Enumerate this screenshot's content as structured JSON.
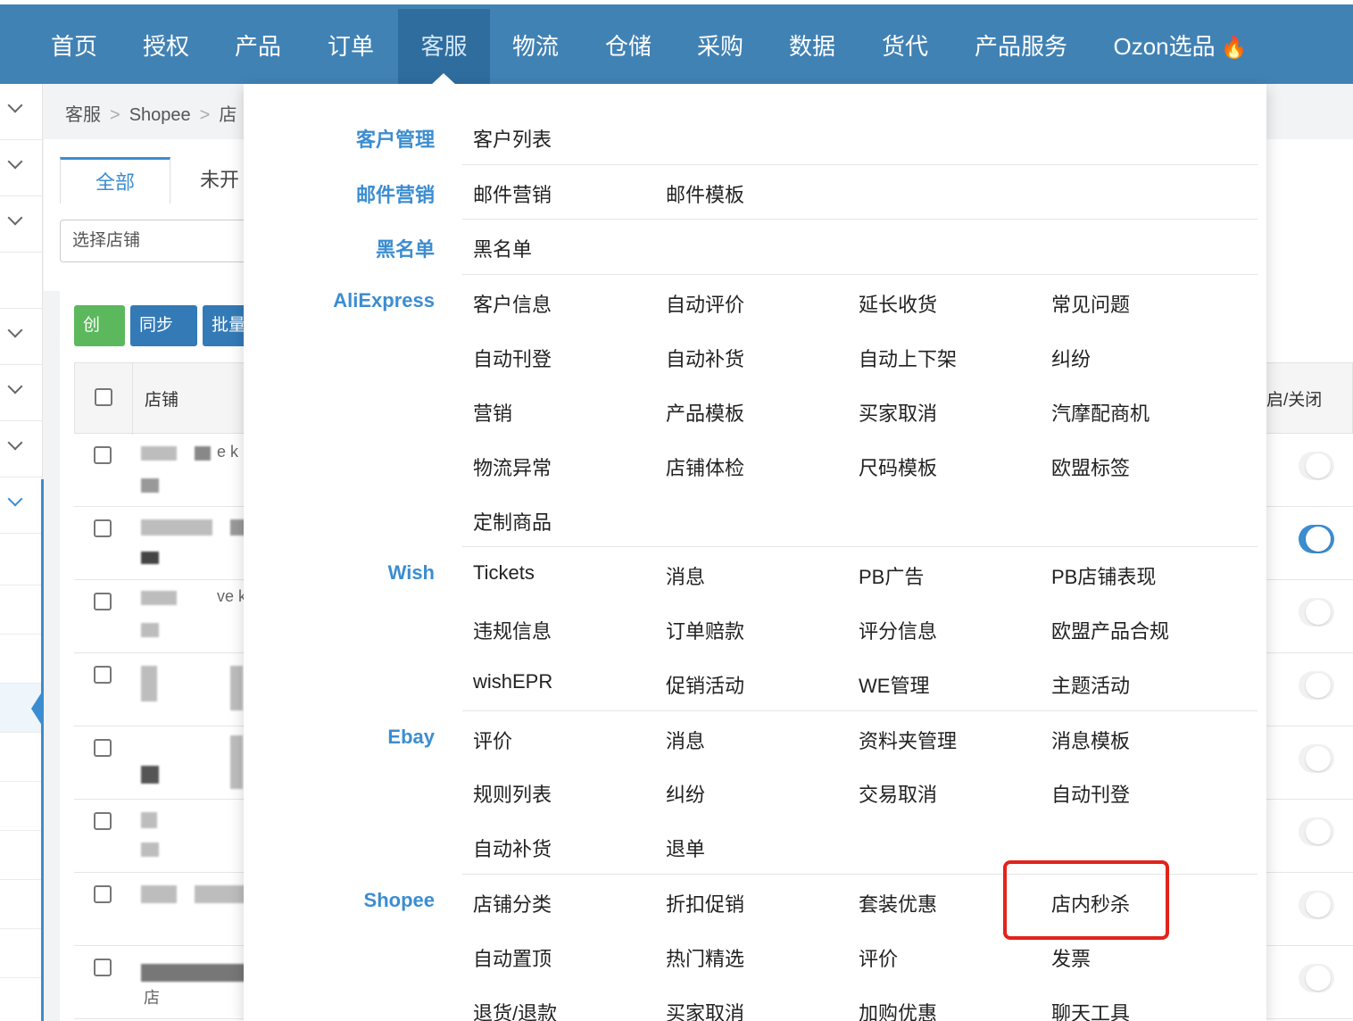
{
  "nav": {
    "items": [
      "首页",
      "授权",
      "产品",
      "订单",
      "客服",
      "物流",
      "仓储",
      "采购",
      "数据",
      "货代",
      "产品服务",
      "Ozon选品"
    ],
    "active": "客服",
    "fire_icon": "fire-icon"
  },
  "breadcrumb": [
    "客服",
    "Shopee",
    "店"
  ],
  "tabs": [
    "全部",
    "未开"
  ],
  "select_shop_placeholder": "选择店铺",
  "buttons": {
    "create": "创建",
    "sync": "同步",
    "batch": "批量"
  },
  "table": {
    "col_shop": "店铺",
    "col_switch": "启/关闭",
    "row_text_1": "e k",
    "row_text_3": "ve k",
    "row_text_8": "店"
  },
  "menu": {
    "groups": [
      {
        "category": "客户管理",
        "rows": [
          [
            "客户列表"
          ]
        ]
      },
      {
        "category": "邮件营销",
        "rows": [
          [
            "邮件营销",
            "邮件模板"
          ]
        ]
      },
      {
        "category": "黑名单",
        "rows": [
          [
            "黑名单"
          ]
        ]
      },
      {
        "category": "AliExpress",
        "rows": [
          [
            "客户信息",
            "自动评价",
            "延长收货",
            "常见问题"
          ],
          [
            "自动刊登",
            "自动补货",
            "自动上下架",
            "纠纷"
          ],
          [
            "营销",
            "产品模板",
            "买家取消",
            "汽摩配商机"
          ],
          [
            "物流异常",
            "店铺体检",
            "尺码模板",
            "欧盟标签"
          ],
          [
            "定制商品"
          ]
        ]
      },
      {
        "category": "Wish",
        "rows": [
          [
            "Tickets",
            "消息",
            "PB广告",
            "PB店铺表现"
          ],
          [
            "违规信息",
            "订单赔款",
            "评分信息",
            "欧盟产品合规"
          ],
          [
            "wishEPR",
            "促销活动",
            "WE管理",
            "主题活动"
          ]
        ]
      },
      {
        "category": "Ebay",
        "rows": [
          [
            "评价",
            "消息",
            "资料夹管理",
            "消息模板"
          ],
          [
            "规则列表",
            "纠纷",
            "交易取消",
            "自动刊登"
          ],
          [
            "自动补货",
            "退单"
          ]
        ]
      },
      {
        "category": "Shopee",
        "rows": [
          [
            "店铺分类",
            "折扣促销",
            "套装优惠",
            "店内秒杀"
          ],
          [
            "自动置顶",
            "热门精选",
            "评价",
            "发票"
          ],
          [
            "退货/退款",
            "买家取消",
            "加购优惠",
            "聊天工具"
          ]
        ]
      }
    ],
    "highlighted_item": "店内秒杀"
  },
  "colors": {
    "nav_bg": "#4182b5",
    "nav_active": "#2f6d9f",
    "accent": "#3c8dd0",
    "highlight_border": "#e2231a",
    "create_btn": "#5cb85c",
    "primary_btn": "#337ab7"
  }
}
